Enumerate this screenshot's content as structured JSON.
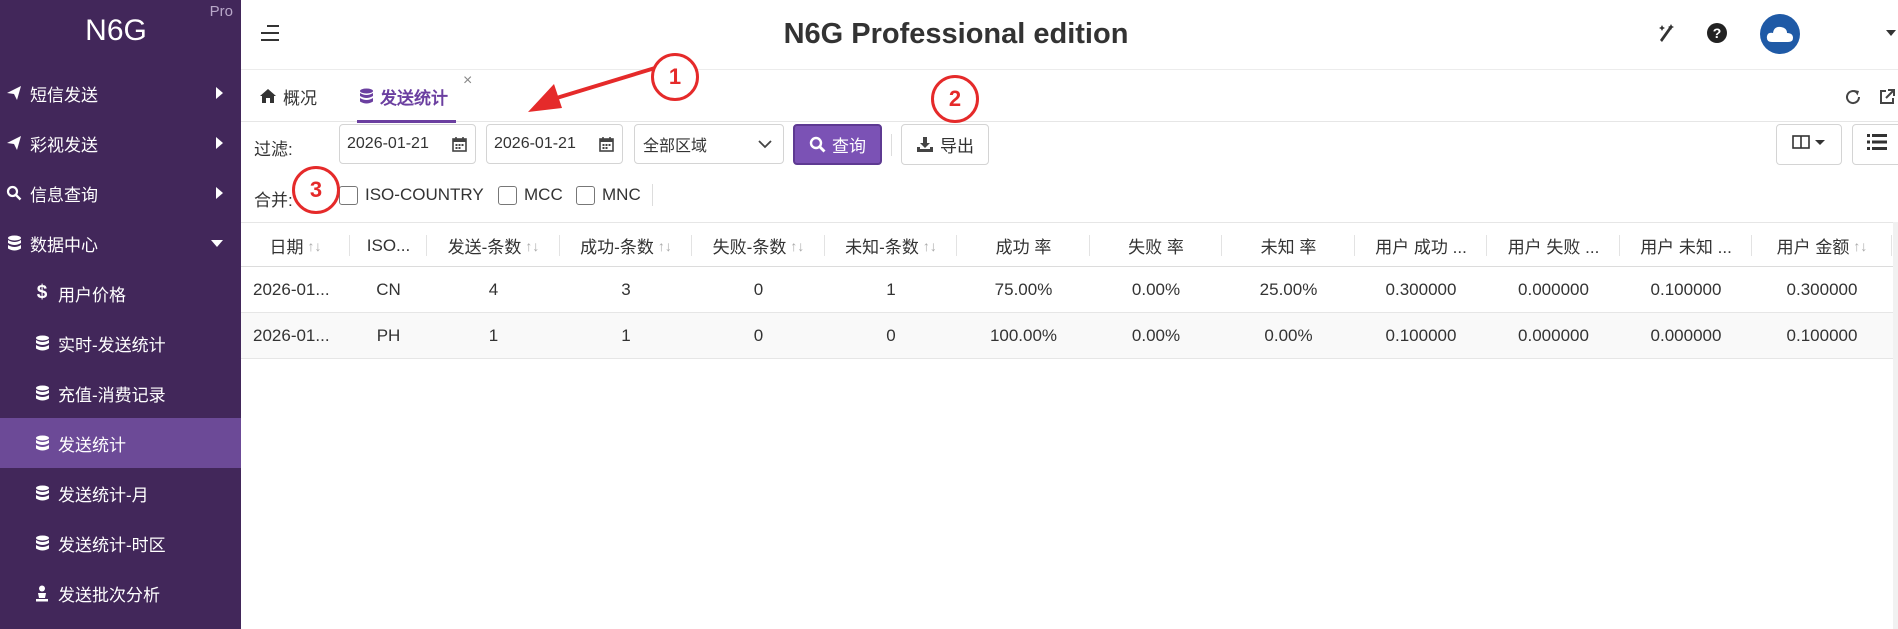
{
  "brand": {
    "title": "N6G",
    "badge": "Pro"
  },
  "sidebar": {
    "items": [
      {
        "label": "短信发送",
        "icon": "paper-plane-icon"
      },
      {
        "label": "彩视发送",
        "icon": "paper-plane-icon"
      },
      {
        "label": "信息查询",
        "icon": "search-icon"
      },
      {
        "label": "数据中心",
        "icon": "database-icon"
      },
      {
        "label": "用户价格",
        "icon": "dollar-icon"
      },
      {
        "label": "实时-发送统计",
        "icon": "database-icon"
      },
      {
        "label": "充值-消费记录",
        "icon": "database-icon"
      },
      {
        "label": "发送统计",
        "icon": "database-icon",
        "active": true
      },
      {
        "label": "发送统计-月",
        "icon": "database-icon"
      },
      {
        "label": "发送统计-时区",
        "icon": "database-icon"
      },
      {
        "label": "发送批次分析",
        "icon": "person-icon"
      }
    ]
  },
  "header": {
    "title": "N6G Professional edition"
  },
  "tabs": [
    {
      "label": "概况",
      "icon": "home-icon"
    },
    {
      "label": "发送统计",
      "icon": "database-icon",
      "active": true,
      "close": "×"
    }
  ],
  "filter": {
    "label": "过滤:",
    "date_from": "2026-01-21",
    "date_to": "2026-01-21",
    "region": "全部区域",
    "query_label": "查询",
    "export_label": "导出"
  },
  "merge": {
    "label": "合并:",
    "options": [
      "ISO-COUNTRY",
      "MCC",
      "MNC"
    ]
  },
  "table": {
    "columns": [
      "日期",
      "ISO...",
      "发送-条数",
      "成功-条数",
      "失败-条数",
      "未知-条数",
      "成功 率",
      "失败 率",
      "未知 率",
      "用户 成功 ...",
      "用户 失败 ...",
      "用户 未知 ...",
      "用户 金额"
    ],
    "sort_glyph": "↑↓",
    "rows": [
      [
        "2026-01...",
        "CN",
        "4",
        "3",
        "0",
        "1",
        "75.00%",
        "0.00%",
        "25.00%",
        "0.300000",
        "0.000000",
        "0.100000",
        "0.300000"
      ],
      [
        "2026-01...",
        "PH",
        "1",
        "1",
        "0",
        "0",
        "100.00%",
        "0.00%",
        "0.00%",
        "0.100000",
        "0.000000",
        "0.000000",
        "0.100000"
      ]
    ]
  },
  "annotations": [
    "1",
    "2",
    "3"
  ],
  "colors": {
    "sidebar": "#42275a",
    "active": "#6c4a97",
    "accent": "#7b52b5",
    "annotation": "#e52a2a"
  }
}
